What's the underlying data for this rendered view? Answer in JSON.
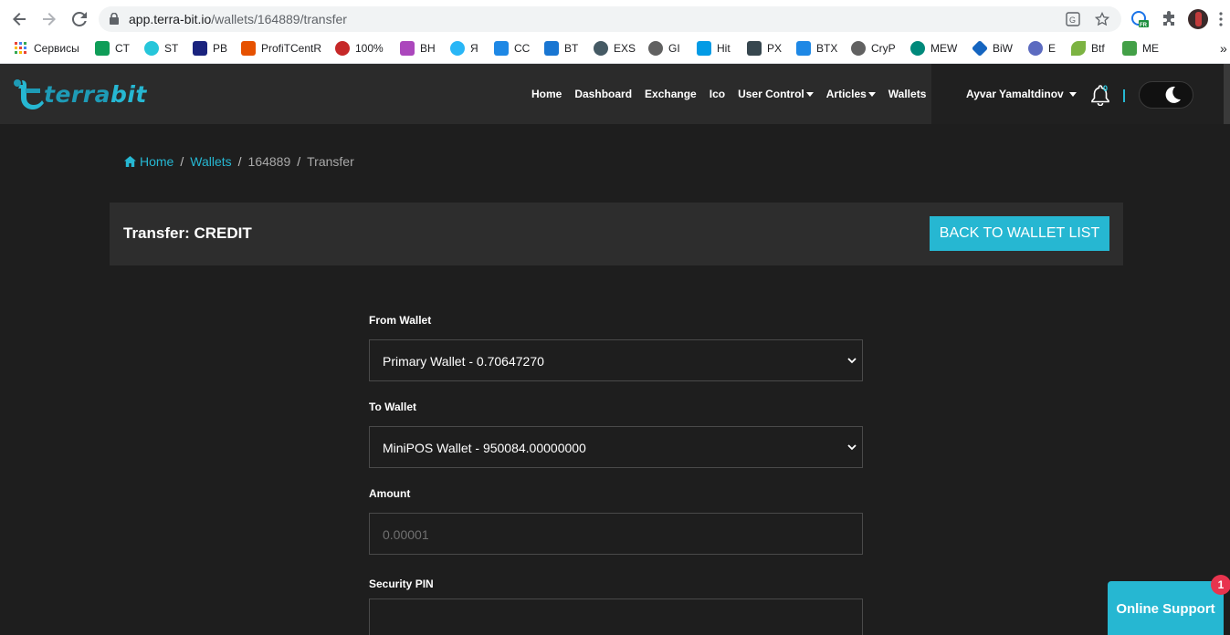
{
  "browser": {
    "url_host": "app.terra-bit.io",
    "url_path": "/wallets/164889/transfer",
    "bookmarks": [
      {
        "label": "Сервисы",
        "color": "#4285f4"
      },
      {
        "label": "CT",
        "color": "#0f9d58"
      },
      {
        "label": "ST",
        "color": "#26c6da"
      },
      {
        "label": "PB",
        "color": "#1a237e"
      },
      {
        "label": "ProfiTCentR",
        "color": "#e65100"
      },
      {
        "label": "100%",
        "color": "#c62828"
      },
      {
        "label": "BH",
        "color": "#ab47bc"
      },
      {
        "label": "Я",
        "color": "#29b6f6"
      },
      {
        "label": "CC",
        "color": "#1e88e5"
      },
      {
        "label": "BT",
        "color": "#1976d2"
      },
      {
        "label": "EXS",
        "color": "#455a64"
      },
      {
        "label": "GI",
        "color": "#616161"
      },
      {
        "label": "Hit",
        "color": "#039be5"
      },
      {
        "label": "PX",
        "color": "#37474f"
      },
      {
        "label": "BTX",
        "color": "#1e88e5"
      },
      {
        "label": "CryP",
        "color": "#616161"
      },
      {
        "label": "MEW",
        "color": "#00897b"
      },
      {
        "label": "BiW",
        "color": "#1565c0"
      },
      {
        "label": "E",
        "color": "#5c6bc0"
      },
      {
        "label": "Btf",
        "color": "#7cb342"
      },
      {
        "label": "ME",
        "color": "#43a047"
      }
    ],
    "overflow": "»"
  },
  "app": {
    "logo_part1": "terra",
    "logo_part2": "bit",
    "nav": {
      "home": "Home",
      "dashboard": "Dashboard",
      "exchange": "Exchange",
      "ico": "Ico",
      "user_control": "User Control",
      "articles": "Articles",
      "wallets": "Wallets"
    },
    "user_name": "Ayvar Yamaltdinov",
    "notifications_count": "0",
    "accent": "#26b7d2"
  },
  "breadcrumb": {
    "home": "Home",
    "wallets": "Wallets",
    "wallet_id": "164889",
    "current": "Transfer",
    "sep": "/"
  },
  "card": {
    "title": "Transfer: CREDIT",
    "back_label": "BACK TO WALLET LIST"
  },
  "form": {
    "from_label": "From Wallet",
    "from_value": "Primary Wallet - 0.70647270",
    "to_label": "To Wallet",
    "to_value": "MiniPOS Wallet - 950084.00000000",
    "amount_label": "Amount",
    "amount_placeholder": "0.00001",
    "pin_label": "Security PIN",
    "pin_value": ""
  },
  "support": {
    "label": "Online Support",
    "badge": "1"
  }
}
